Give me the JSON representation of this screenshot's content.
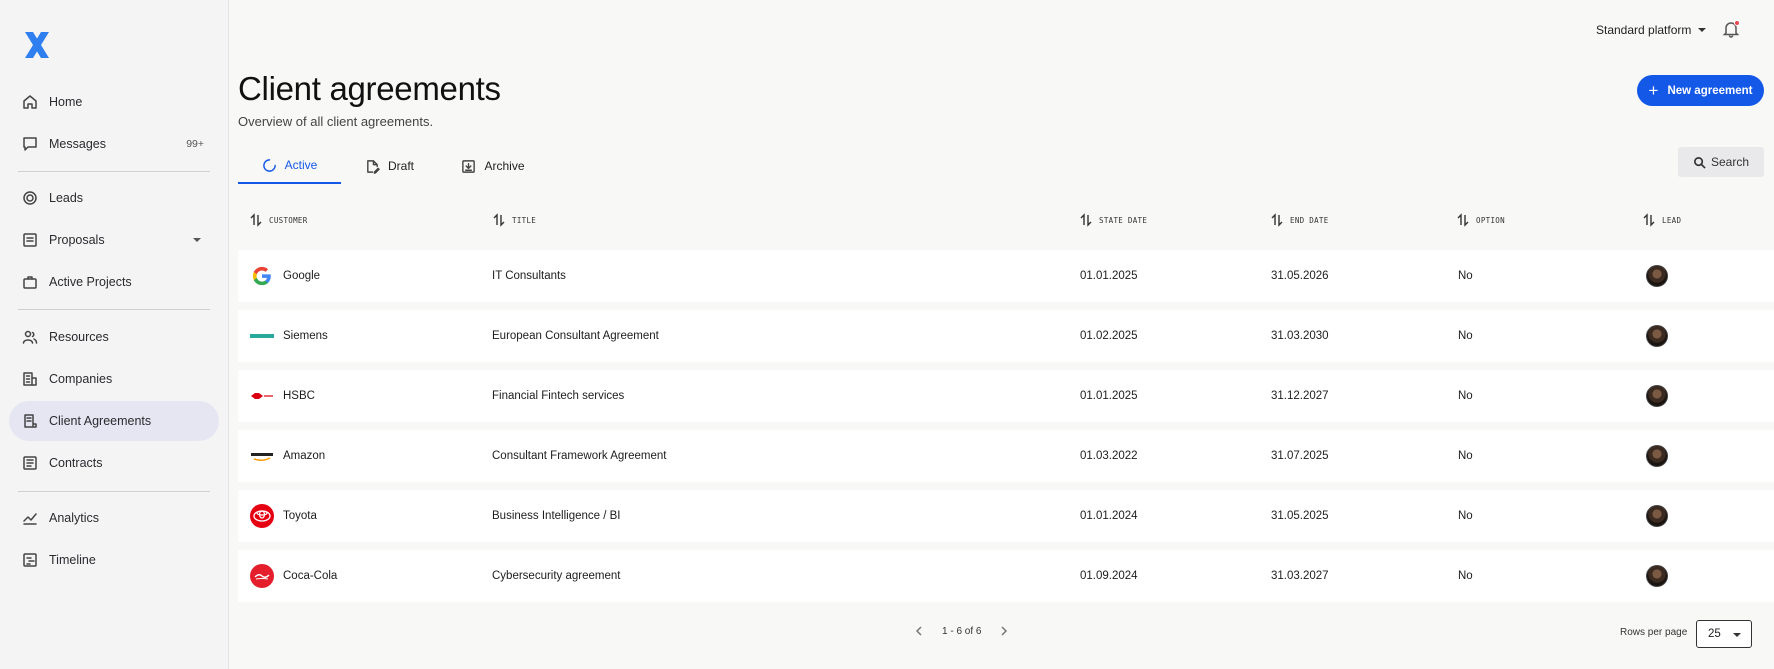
{
  "sidebar": {
    "logo_icon": "x-logo-icon",
    "items": [
      {
        "label": "Home",
        "icon": "home-icon"
      },
      {
        "label": "Messages",
        "icon": "chat-icon",
        "badge": "99+"
      },
      {
        "label": "Leads",
        "icon": "target-icon"
      },
      {
        "label": "Proposals",
        "icon": "proposal-icon"
      },
      {
        "label": "Active Projects",
        "icon": "briefcase-icon"
      },
      {
        "label": "Resources",
        "icon": "people-icon"
      },
      {
        "label": "Companies",
        "icon": "building-icon"
      },
      {
        "label": "Client Agreements",
        "icon": "agreement-icon",
        "active": true
      },
      {
        "label": "Contracts",
        "icon": "contract-icon"
      },
      {
        "label": "Analytics",
        "icon": "chart-icon"
      },
      {
        "label": "Timeline",
        "icon": "timeline-icon"
      }
    ]
  },
  "topbar": {
    "platform_label": "Standard platform",
    "bell_icon": "bell-icon"
  },
  "header": {
    "title": "Client agreements",
    "subtitle": "Overview of all client agreements.",
    "new_button": "New agreement"
  },
  "tabs": [
    {
      "label": "Active",
      "icon": "spinner-icon",
      "active": true
    },
    {
      "label": "Draft",
      "icon": "draft-icon"
    },
    {
      "label": "Archive",
      "icon": "archive-icon"
    }
  ],
  "search_label": "Search",
  "table": {
    "columns": [
      "CUSTOMER",
      "TITLE",
      "STATE DATE",
      "END DATE",
      "OPTION",
      "LEAD"
    ],
    "rows": [
      {
        "customer": "Google",
        "logo": "google-logo",
        "title": "IT Consultants",
        "start": "01.01.2025",
        "end": "31.05.2026",
        "option": "No"
      },
      {
        "customer": "Siemens",
        "logo": "siemens-logo",
        "title": "European Consultant Agreement",
        "start": "01.02.2025",
        "end": "31.03.2030",
        "option": "No"
      },
      {
        "customer": "HSBC",
        "logo": "hsbc-logo",
        "title": "Financial Fintech services",
        "start": "01.01.2025",
        "end": "31.12.2027",
        "option": "No"
      },
      {
        "customer": "Amazon",
        "logo": "amazon-logo",
        "title": "Consultant Framework Agreement",
        "start": "01.03.2022",
        "end": "31.07.2025",
        "option": "No"
      },
      {
        "customer": "Toyota",
        "logo": "toyota-logo",
        "title": "Business Intelligence / BI",
        "start": "01.01.2024",
        "end": "31.05.2025",
        "option": "No"
      },
      {
        "customer": "Coca-Cola",
        "logo": "coca-cola-logo",
        "title": "Cybersecurity agreement",
        "start": "01.09.2024",
        "end": "31.03.2027",
        "option": "No"
      }
    ]
  },
  "pagination": {
    "range": "1 - 6 of 6",
    "rows_per_page_label": "Rows per page",
    "rows_per_page": "25"
  },
  "colors": {
    "accent": "#1458e8",
    "active_nav_bg": "#e6e6f3"
  }
}
